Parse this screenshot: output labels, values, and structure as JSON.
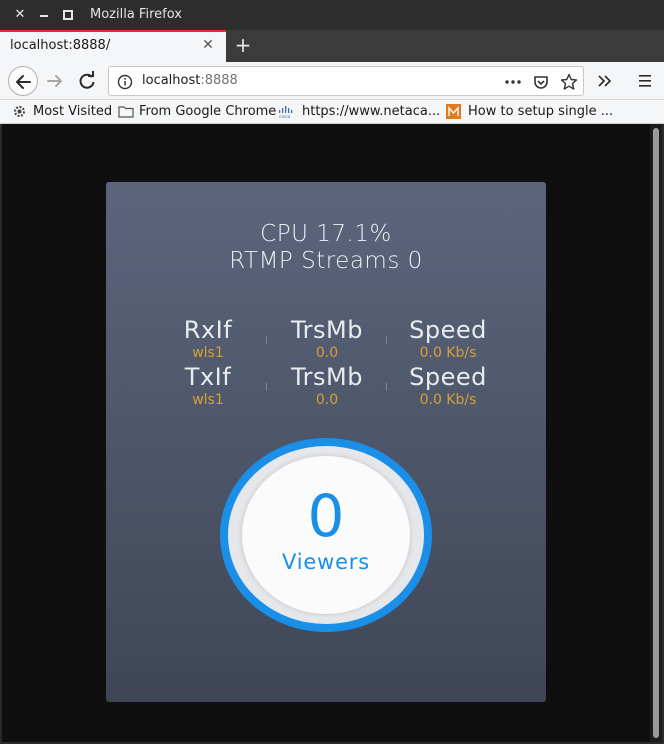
{
  "window": {
    "title": "Mozilla Firefox"
  },
  "tab": {
    "title": "localhost:8888/"
  },
  "urlbar": {
    "host": "localhost",
    "port": ":8888"
  },
  "bookmarks": [
    {
      "label": "Most Visited",
      "icon": "gear-icon"
    },
    {
      "label": "From Google Chrome",
      "icon": "folder-icon"
    },
    {
      "label": "https://www.netaca...",
      "icon": "cisco-icon"
    },
    {
      "label": "How to setup single ...",
      "icon": "site-favicon-icon"
    }
  ],
  "dashboard": {
    "cpu": "CPU 17.1%",
    "streams": "RTMP Streams 0",
    "rx": {
      "iface_label": "RxIf",
      "iface": "wls1",
      "mb_label": "TrsMb",
      "mb": "0.0",
      "speed_label": "Speed",
      "speed": "0.0 Kb/s"
    },
    "tx": {
      "iface_label": "TxIf",
      "iface": "wls1",
      "mb_label": "TrsMb",
      "mb": "0.0",
      "speed_label": "Speed",
      "speed": "0.0 Kb/s"
    },
    "viewers": {
      "count": "0",
      "label": "Viewers"
    }
  },
  "colors": {
    "accent": "#1a8fe8",
    "value": "#d5a134",
    "tab_highlight": "#e0302b"
  }
}
